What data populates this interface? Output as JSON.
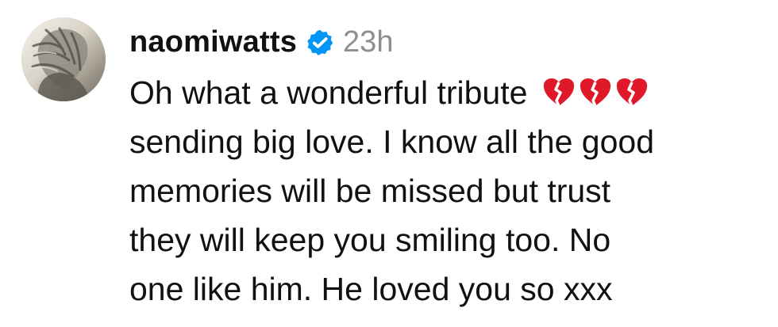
{
  "comment": {
    "username": "naomiwatts",
    "timestamp": "23h",
    "lines": [
      "Oh what a wonderful tribute",
      "sending big love. I know all the good",
      "memories will be missed but trust",
      "they will keep you smiling too. No",
      "one like him. He loved you so xxx"
    ],
    "emoji": [
      "💔",
      "💔",
      "💔"
    ]
  },
  "icons": {
    "avatar": "profile-photo",
    "verified": "verified-badge-icon",
    "emoji": "broken-heart-icon"
  },
  "colors": {
    "verified_blue": "#0095f6",
    "timestamp_gray": "#8e8e8e",
    "emoji_red": "#e0192a",
    "text_black": "#111111"
  }
}
